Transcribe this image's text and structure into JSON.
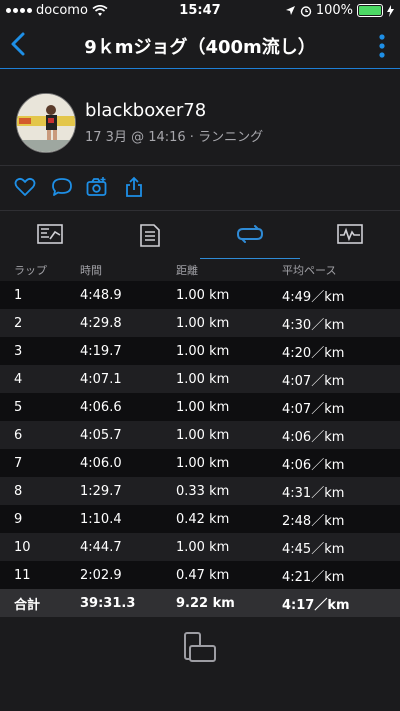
{
  "status_bar": {
    "carrier": "docomo",
    "time": "15:47",
    "battery": "100%"
  },
  "nav": {
    "title": "9ｋmジョグ（400m流し）"
  },
  "profile": {
    "username": "blackboxer78",
    "meta": "17 3月 @ 14:16 · ランニング"
  },
  "table": {
    "headers": [
      "ラップ",
      "時間",
      "距離",
      "平均ペース"
    ],
    "rows": [
      [
        "1",
        "4:48.9",
        "1.00 km",
        "4:49／km"
      ],
      [
        "2",
        "4:29.8",
        "1.00 km",
        "4:30／km"
      ],
      [
        "3",
        "4:19.7",
        "1.00 km",
        "4:20／km"
      ],
      [
        "4",
        "4:07.1",
        "1.00 km",
        "4:07／km"
      ],
      [
        "5",
        "4:06.6",
        "1.00 km",
        "4:07／km"
      ],
      [
        "6",
        "4:05.7",
        "1.00 km",
        "4:06／km"
      ],
      [
        "7",
        "4:06.0",
        "1.00 km",
        "4:06／km"
      ],
      [
        "8",
        "1:29.7",
        "0.33 km",
        "4:31／km"
      ],
      [
        "9",
        "1:10.4",
        "0.42 km",
        "2:48／km"
      ],
      [
        "10",
        "4:44.7",
        "1.00 km",
        "4:45／km"
      ],
      [
        "11",
        "2:02.9",
        "0.47 km",
        "4:21／km"
      ]
    ],
    "total": [
      "合計",
      "39:31.3",
      "9.22 km",
      "4:17／km"
    ]
  },
  "colors": {
    "accent": "#2f8bd6",
    "background": "#1b1b1d",
    "battery": "#4cd964"
  },
  "icons": [
    "wifi-icon",
    "location-icon",
    "alarm-icon",
    "charging-icon",
    "back-icon",
    "more-icon",
    "like-icon",
    "comment-icon",
    "add-photo-icon",
    "share-icon",
    "summary-tab-icon",
    "details-tab-icon",
    "laps-tab-icon",
    "chart-tab-icon",
    "rotate-icon"
  ]
}
